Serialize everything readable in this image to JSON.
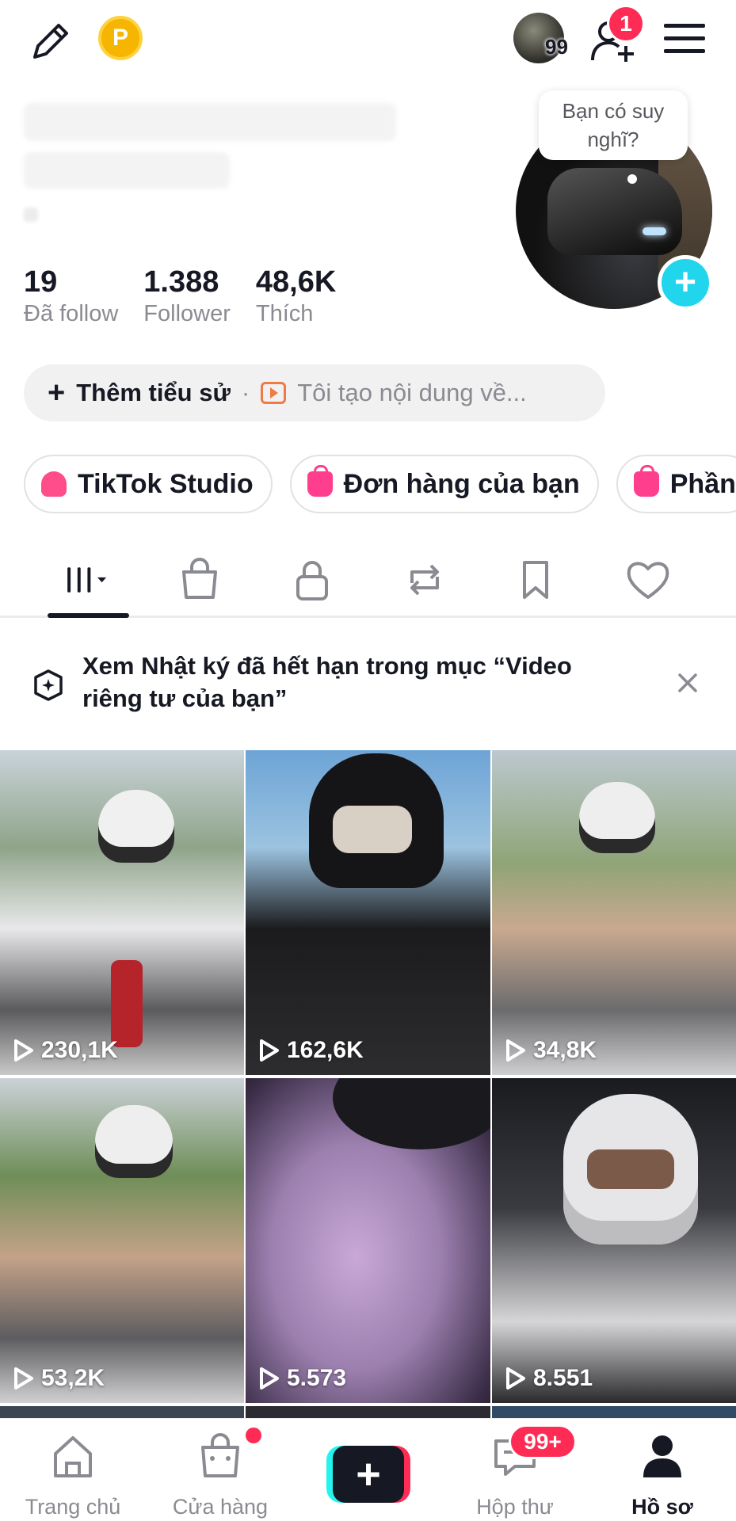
{
  "header": {
    "coin_letter": "P",
    "story_count": "99",
    "notification_count": "1"
  },
  "profile": {
    "avatar_bubble": "Bạn có suy nghĩ?",
    "stats": [
      {
        "value": "19",
        "label": "Đã follow"
      },
      {
        "value": "1.388",
        "label": "Follower"
      },
      {
        "value": "48,6K",
        "label": "Thích"
      }
    ],
    "bio_add_label": "Thêm tiểu sử",
    "bio_separator": "·",
    "bio_suggestion": "Tôi tạo nội dung về..."
  },
  "chips": [
    {
      "label": "TikTok Studio"
    },
    {
      "label": "Đơn hàng của bạn"
    },
    {
      "label": "Phần"
    }
  ],
  "tabs": [
    "videos-grid",
    "shop",
    "private",
    "reposts",
    "favorites",
    "liked"
  ],
  "banner": {
    "text": "Xem Nhật ký đã hết hạn trong mục “Video riêng tư của bạn”"
  },
  "videos": [
    {
      "views": "230,1K"
    },
    {
      "views": "162,6K"
    },
    {
      "views": "34,8K"
    },
    {
      "views": "53,2K"
    },
    {
      "views": "5.573"
    },
    {
      "views": "8.551"
    }
  ],
  "bottom_nav": {
    "home": "Trang chủ",
    "shop": "Cửa hàng",
    "inbox": "Hộp thư",
    "inbox_badge": "99+",
    "profile": "Hồ sơ"
  },
  "colors": {
    "accent_red": "#fe2c55",
    "accent_cyan": "#25f4ee",
    "text_primary": "#161823",
    "text_secondary": "#8a8b91"
  }
}
